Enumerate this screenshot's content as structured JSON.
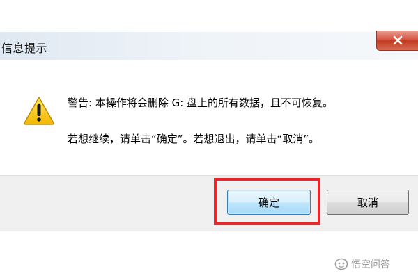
{
  "dialog": {
    "title": "信息提示",
    "close_icon": "close-icon",
    "warning_icon": "warning-triangle-icon",
    "message_line1": "警告: 本操作将会删除 G: 盘上的所有数据，且不可恢复。",
    "message_line2": "若想继续，请单击“确定”。若想退出，请单击“取消”。"
  },
  "buttons": {
    "ok_label": "确定",
    "cancel_label": "取消"
  },
  "annotation": {
    "highlight_color": "#e8262b"
  },
  "watermark": {
    "text": "悟空问答"
  },
  "colors": {
    "close_button": "#c43a22",
    "ok_button_border": "#3c7fb1",
    "warning_yellow": "#f5c400"
  }
}
